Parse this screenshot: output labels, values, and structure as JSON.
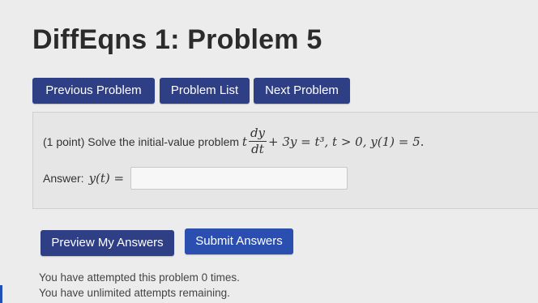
{
  "page": {
    "title": "DiffEqns 1: Problem 5"
  },
  "nav": {
    "previous_label": "Previous Problem",
    "list_label": "Problem List",
    "next_label": "Next Problem"
  },
  "problem": {
    "points": "(1 point)",
    "prompt": "Solve the initial-value problem",
    "equation": {
      "t": "t",
      "numerator": "dy",
      "denominator": "dt",
      "rest": "+ 3y = t³,  t > 0,  y(1) = 5."
    },
    "answer_label": "Answer:",
    "answer_lhs": "y(t) =",
    "answer_value": ""
  },
  "actions": {
    "preview_label": "Preview My Answers",
    "submit_label": "Submit Answers"
  },
  "status": {
    "attempts": "You have attempted this problem 0 times.",
    "remaining": "You have unlimited attempts remaining."
  },
  "colors": {
    "button": "#2f3f86",
    "submit": "#2a4fb0",
    "panel": "#e6e6e6",
    "background": "#ececec"
  }
}
